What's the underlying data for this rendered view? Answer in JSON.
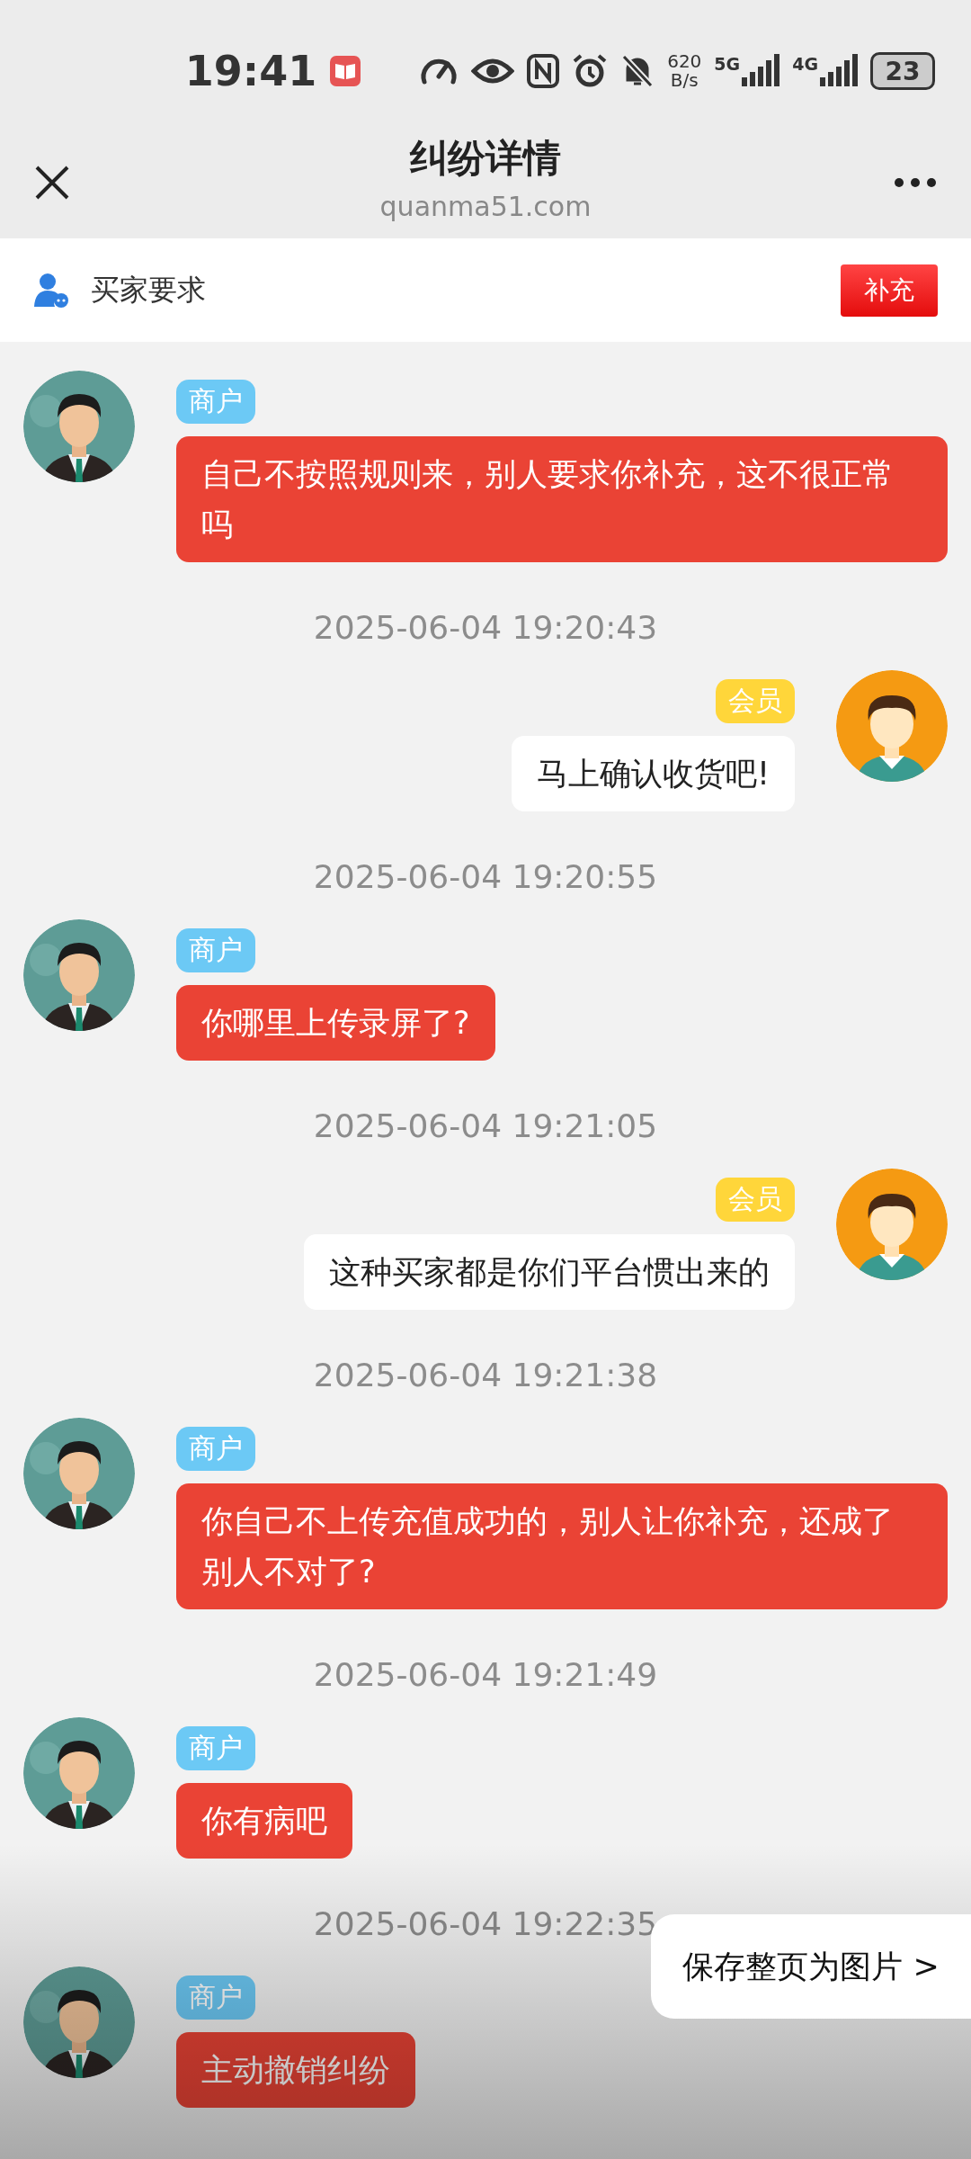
{
  "status_bar": {
    "time": "19:41",
    "net_speed": "620",
    "net_unit": "B/s",
    "signal_1": "5G",
    "signal_2": "4G",
    "battery": "23"
  },
  "header": {
    "title": "纠纷详情",
    "subtitle": "quanma51.com"
  },
  "request_bar": {
    "label": "买家要求",
    "button": "补充"
  },
  "items": [
    {
      "kind": "merchant",
      "tag": "商户",
      "text": "自己不按照规则来，别人要求你补充，这不很正常吗"
    },
    {
      "kind": "timestamp",
      "text": "2025-06-04 19:20:43"
    },
    {
      "kind": "member",
      "tag": "会员",
      "text": "马上确认收货吧!"
    },
    {
      "kind": "timestamp",
      "text": "2025-06-04 19:20:55"
    },
    {
      "kind": "merchant",
      "tag": "商户",
      "text": "你哪里上传录屏了?"
    },
    {
      "kind": "timestamp",
      "text": "2025-06-04 19:21:05"
    },
    {
      "kind": "member",
      "tag": "会员",
      "text": "这种买家都是你们平台惯出来的"
    },
    {
      "kind": "timestamp",
      "text": "2025-06-04 19:21:38"
    },
    {
      "kind": "merchant",
      "tag": "商户",
      "text": "你自己不上传充值成功的，别人让你补充，还成了别人不对了?"
    },
    {
      "kind": "timestamp",
      "text": "2025-06-04 19:21:49"
    },
    {
      "kind": "merchant",
      "tag": "商户",
      "text": "你有病吧"
    },
    {
      "kind": "timestamp",
      "text": "2025-06-04 19:22:35"
    },
    {
      "kind": "merchant",
      "tag": "商户",
      "text": "主动撤销纠纷"
    }
  ],
  "save_button": "保存整页为图片 >"
}
